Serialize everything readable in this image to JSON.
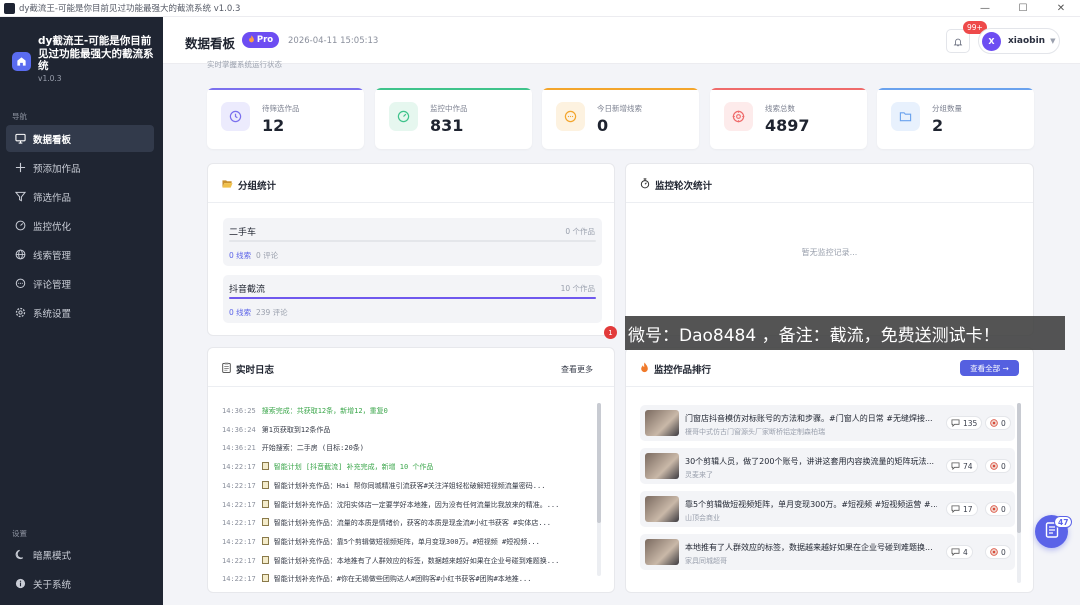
{
  "window": {
    "title": "dy截流王-可能是你目前见过功能最强大的截流系统 v1.0.3",
    "buttons": [
      "—",
      "☐",
      "✕"
    ]
  },
  "sidebar": {
    "brand_title": "dy截流王-可能是你目前见过功能最强大的截流系统",
    "brand_version": "v1.0.3",
    "nav_section": "导航",
    "nav_items": [
      {
        "label": "数据看板",
        "icon": "monitor-icon",
        "active": true
      },
      {
        "label": "预添加作品",
        "icon": "plus-icon"
      },
      {
        "label": "筛选作品",
        "icon": "filter-icon"
      },
      {
        "label": "监控优化",
        "icon": "gauge-icon"
      },
      {
        "label": "线索管理",
        "icon": "globe-icon"
      },
      {
        "label": "评论管理",
        "icon": "comment-icon"
      },
      {
        "label": "系统设置",
        "icon": "gear-icon"
      }
    ],
    "settings_section": "设置",
    "bottom_items": [
      {
        "label": "暗黑模式",
        "icon": "moon-icon"
      },
      {
        "label": "关于系统",
        "icon": "info-icon"
      }
    ]
  },
  "header": {
    "title": "数据看板",
    "badge": "Pro",
    "datetime": "2026-04-11 15:05:13",
    "notification_count": "99+",
    "avatar_letter": "X",
    "username": "xiaobin"
  },
  "cut_text": "实时掌握系统运行状态",
  "stats": [
    {
      "label": "待筛选作品",
      "value": "12",
      "color": "#7b70ee",
      "icon": "clock-icon"
    },
    {
      "label": "监控中作品",
      "value": "831",
      "color": "#3fc38b",
      "icon": "speedometer-icon"
    },
    {
      "label": "今日新增线索",
      "value": "0",
      "color": "#f3a52c",
      "icon": "chat-icon"
    },
    {
      "label": "线索总数",
      "value": "4897",
      "color": "#ef6b6b",
      "icon": "target-icon"
    },
    {
      "label": "分组数量",
      "value": "2",
      "color": "#6aa2ee",
      "icon": "folder-icon"
    }
  ],
  "group_panel": {
    "title": "分组统计",
    "groups": [
      {
        "name": "二手车",
        "count": "0 个作品",
        "leads": "0 线索",
        "comments": "0 评论",
        "progress": 0
      },
      {
        "name": "抖音截流",
        "count": "10 个作品",
        "leads": "0 线索",
        "comments": "239 评论",
        "progress": 1
      }
    ]
  },
  "monitor_panel": {
    "title": "监控轮次统计",
    "empty": "暂无监控记录..."
  },
  "log_panel": {
    "title": "实时日志",
    "more": "查看更多",
    "lines": [
      {
        "time": "14:36:25",
        "msg": "搜索完成：共获取12条，新增12，重复0",
        "green": true,
        "doc": false
      },
      {
        "time": "14:36:24",
        "msg": "第1页获取到12条作品",
        "green": false,
        "doc": false
      },
      {
        "time": "14:36:21",
        "msg": "开始搜索：二手房 (目标:20条)",
        "green": false,
        "doc": false
      },
      {
        "time": "14:22:17",
        "msg": "智能计划 [抖音截流] 补充完成，新增 10 个作品",
        "green": true,
        "doc": true
      },
      {
        "time": "14:22:17",
        "msg": "智能计划补充作品：Hai 帮你同城精准引流获客#关注洋姐轻松破解短视频流量密码...",
        "green": false,
        "doc": true
      },
      {
        "time": "14:22:17",
        "msg": "智能计划补充作品：沈阳实体店一定要学好本地推，因为没有任何流量比我放来的精准。...",
        "green": false,
        "doc": true
      },
      {
        "time": "14:22:17",
        "msg": "智能计划补充作品：流量的本质是情绪价，获客的本质是现金流#小红书获客 #实体店...",
        "green": false,
        "doc": true
      },
      {
        "time": "14:22:17",
        "msg": "智能计划补充作品：靠5个剪辑做短视频矩阵，单月变现300万。#短视频 #短视频...",
        "green": false,
        "doc": true
      },
      {
        "time": "14:22:17",
        "msg": "智能计划补充作品：本地推有了人群效应的标签，数据越来越好如果在企业号碰到难题换...",
        "green": false,
        "doc": true
      },
      {
        "time": "14:22:17",
        "msg": "智能计划补充作品：#你在无锡做些团购达人#团购客#小红书获客#团购#本地推...",
        "green": false,
        "doc": true
      }
    ]
  },
  "rank_panel": {
    "title": "监控作品排行",
    "view_all": "查看全部 →",
    "items": [
      {
        "title": "门窗店抖音模仿对标账号的方法和步骤。#门窗人的日常 #无缝焊接...",
        "author": "榎哥中式仿古门窗源头厂家断桥铝定制森柏瑞",
        "comments": "135",
        "leads": "0"
      },
      {
        "title": "30个剪辑人员，做了200个账号，讲讲这套用内容换流量的矩阵玩法...",
        "author": "灵麦来了",
        "comments": "74",
        "leads": "0"
      },
      {
        "title": "靠5个剪辑做短视频矩阵，单月变现300万。#短视频 #短视频运营 #...",
        "author": "山顶会商业",
        "comments": "17",
        "leads": "0"
      },
      {
        "title": "本地推有了人群效应的标签，数据越来越好如果在企业号碰到难题换...",
        "author": "家具同城超哥",
        "comments": "4",
        "leads": "0"
      }
    ]
  },
  "overlay": {
    "dot": "1",
    "text": "微号：Dao8484 ，备注：截流，免费送测试卡！"
  },
  "fab_badge": "47"
}
